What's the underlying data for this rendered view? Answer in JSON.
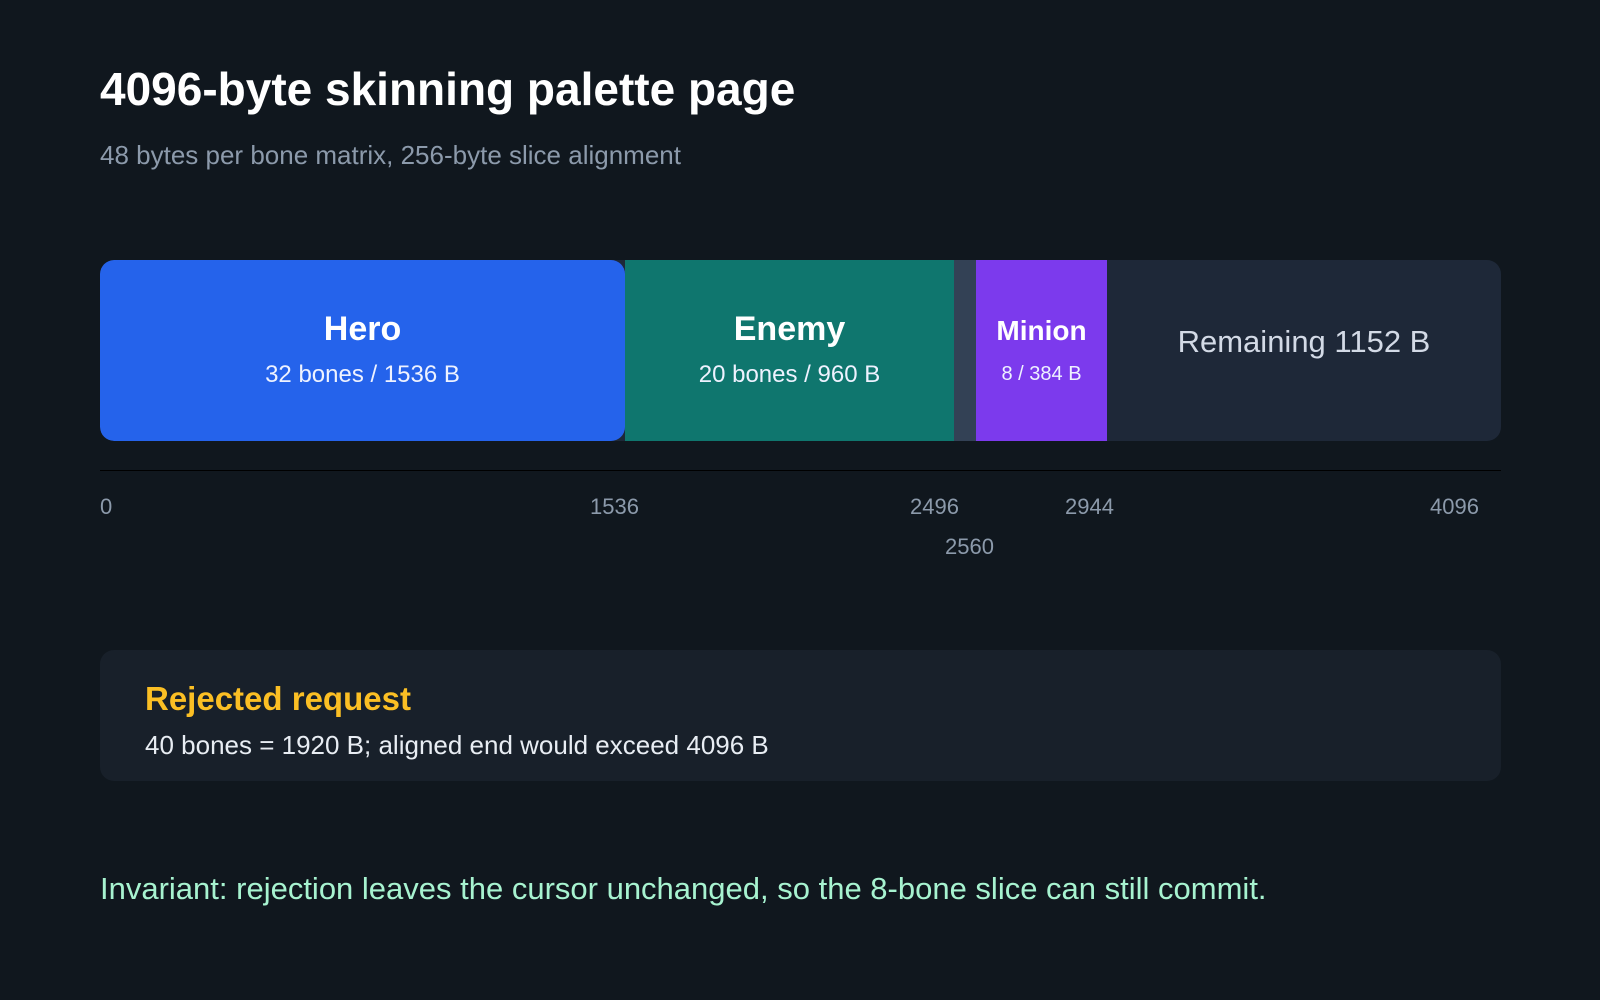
{
  "header": {
    "title": "4096-byte skinning palette page",
    "subtitle": "48 bytes per bone matrix, 256-byte slice alignment"
  },
  "chart_data": {
    "type": "bar",
    "page_size": 4096,
    "segments": [
      {
        "key": "hero",
        "name": "Hero",
        "detail": "32 bones / 1536 B",
        "start": 0,
        "end": 1536,
        "color": "#2563eb"
      },
      {
        "key": "enemy",
        "name": "Enemy",
        "detail": "20 bones / 960 B",
        "start": 1536,
        "end": 2496,
        "color": "#0f766e"
      },
      {
        "key": "alignment_gap",
        "name": "",
        "detail": "",
        "start": 2496,
        "end": 2560,
        "color": "#334155"
      },
      {
        "key": "minion",
        "name": "Minion",
        "detail": "8 / 384 B",
        "start": 2560,
        "end": 2944,
        "color": "#7c3aed"
      },
      {
        "key": "remaining",
        "name": "Remaining 1152 B",
        "detail": "",
        "start": 2944,
        "end": 4096,
        "color": "#1e2838"
      }
    ],
    "ticks": [
      "0",
      "1536",
      "2496",
      "2944",
      "4096",
      "2560"
    ]
  },
  "rejected": {
    "title": "Rejected request",
    "body": "40 bones = 1920 B; aligned end would exceed 4096 B"
  },
  "invariant": "Invariant: rejection leaves the cursor unchanged, so the 8-bone slice can still commit.",
  "colors": {
    "background": "#10171e",
    "panel": "#18202a",
    "warning": "#fbbf24",
    "invariant": "#a7f3d0"
  }
}
